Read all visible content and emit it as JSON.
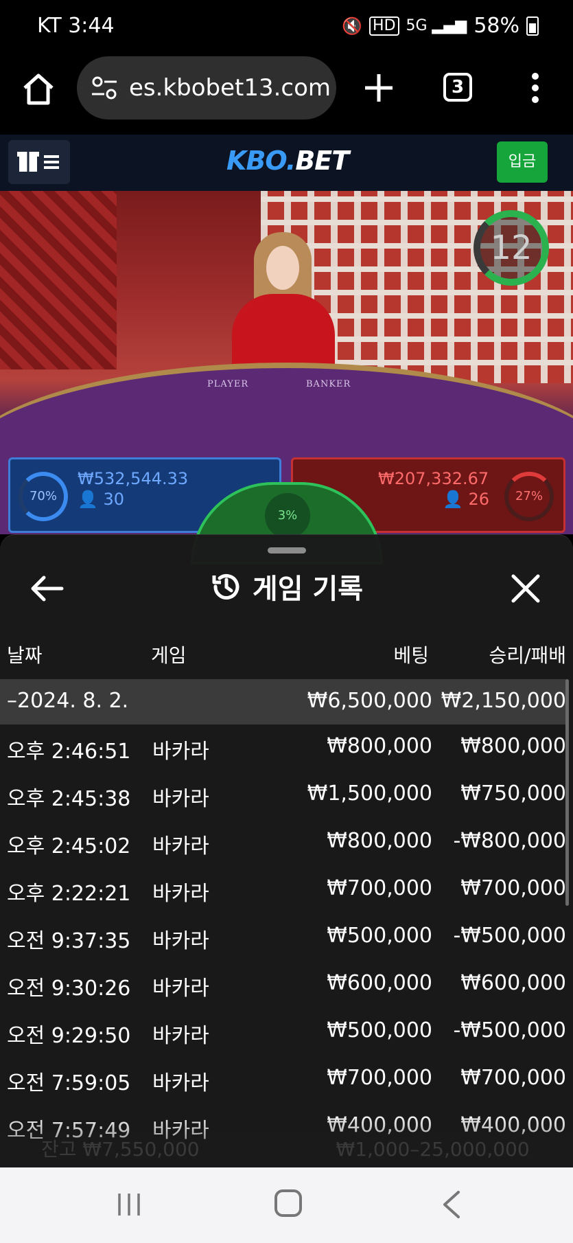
{
  "status_bar": {
    "carrier_time": "KT 3:44",
    "battery": "58%"
  },
  "browser": {
    "url": "es.kbobet13.com",
    "tab_count": "3"
  },
  "site": {
    "logo_kbo": "KBO.",
    "logo_bet": "BET",
    "deposit_label": "입금"
  },
  "video": {
    "timer": "12",
    "felt_player": "PLAYER",
    "felt_banker": "BANKER"
  },
  "bets": {
    "player": {
      "percent": "70%",
      "amount": "₩532,544.33",
      "count": "30"
    },
    "banker": {
      "percent": "27%",
      "amount": "₩207,332.67",
      "count": "26"
    },
    "tie": {
      "percent": "3%"
    }
  },
  "sheet": {
    "title": "게임 기록",
    "columns": {
      "date": "날짜",
      "game": "게임",
      "bet": "베팅",
      "win": "승리/패배"
    },
    "summary": {
      "date": "–2024. 8. 2.",
      "bet": "₩6,500,000",
      "win": "₩2,150,000"
    },
    "rows": [
      {
        "time": "오후 2:46:51",
        "game": "바카라",
        "bet": "₩800,000",
        "win": "₩800,000"
      },
      {
        "time": "오후 2:45:38",
        "game": "바카라",
        "bet": "₩1,500,000",
        "win": "₩750,000"
      },
      {
        "time": "오후 2:45:02",
        "game": "바카라",
        "bet": "₩800,000",
        "win": "-₩800,000"
      },
      {
        "time": "오후 2:22:21",
        "game": "바카라",
        "bet": "₩700,000",
        "win": "₩700,000"
      },
      {
        "time": "오전 9:37:35",
        "game": "바카라",
        "bet": "₩500,000",
        "win": "-₩500,000"
      },
      {
        "time": "오전 9:30:26",
        "game": "바카라",
        "bet": "₩600,000",
        "win": "₩600,000"
      },
      {
        "time": "오전 9:29:50",
        "game": "바카라",
        "bet": "₩500,000",
        "win": "-₩500,000"
      },
      {
        "time": "오전 7:59:05",
        "game": "바카라",
        "bet": "₩700,000",
        "win": "₩700,000"
      },
      {
        "time": "오전 7:57:49",
        "game": "바카라",
        "bet": "₩400,000",
        "win": "₩400,000"
      }
    ],
    "behind": {
      "balance": "잔고 ₩7,550,000",
      "limit": "₩1,000–25,000,000"
    }
  },
  "colors": {
    "player_blue": "#3b8bf0",
    "banker_red": "#e03b3b",
    "tie_green": "#2ec25a",
    "deposit_green": "#16a53a"
  }
}
